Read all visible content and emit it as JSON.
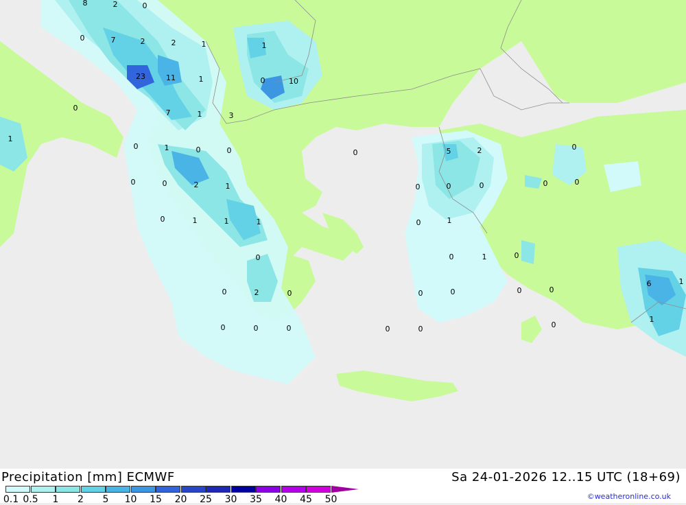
{
  "header": {
    "title": "Precipitation [mm] ECMWF",
    "datetime": "Sa 24-01-2026 12..15 UTC (18+69)",
    "credit": "©weatheronline.co.uk"
  },
  "legend": {
    "colors": [
      "#d2fafa",
      "#aff0f0",
      "#8ce6e6",
      "#64d2e6",
      "#4bb4e6",
      "#3c96e1",
      "#3264dc",
      "#2846c8",
      "#1e28b4",
      "#0000a0",
      "#8c00e6",
      "#b400e6",
      "#d200dc",
      "#eb00e6",
      "#c800c8"
    ],
    "ticks": [
      "0.1",
      "0.5",
      "1",
      "2",
      "5",
      "10",
      "15",
      "20",
      "25",
      "30",
      "35",
      "40",
      "45",
      "50"
    ],
    "arrow_color": "#a000a0"
  },
  "map": {
    "sea_color": "#ededed",
    "land_color": "#c8fa9a",
    "border_color": "#8c8c8c",
    "value_labels": [
      "8",
      "2",
      "0",
      "0",
      "7",
      "2",
      "2",
      "1",
      "1",
      "23",
      "11",
      "1",
      "0",
      "0",
      "10",
      "1",
      "7",
      "3",
      "1",
      "0",
      "1",
      "0",
      "0",
      "0",
      "2",
      "1",
      "0",
      "0",
      "1",
      "1",
      "0",
      "1",
      "2",
      "0",
      "0",
      "0",
      "0",
      "0",
      "5",
      "2",
      "0",
      "0",
      "1",
      "0",
      "0",
      "0",
      "0",
      "0",
      "0",
      "1",
      "0",
      "0",
      "0",
      "0",
      "0",
      "0",
      "0",
      "0",
      "0",
      "6",
      "1",
      "1"
    ]
  }
}
